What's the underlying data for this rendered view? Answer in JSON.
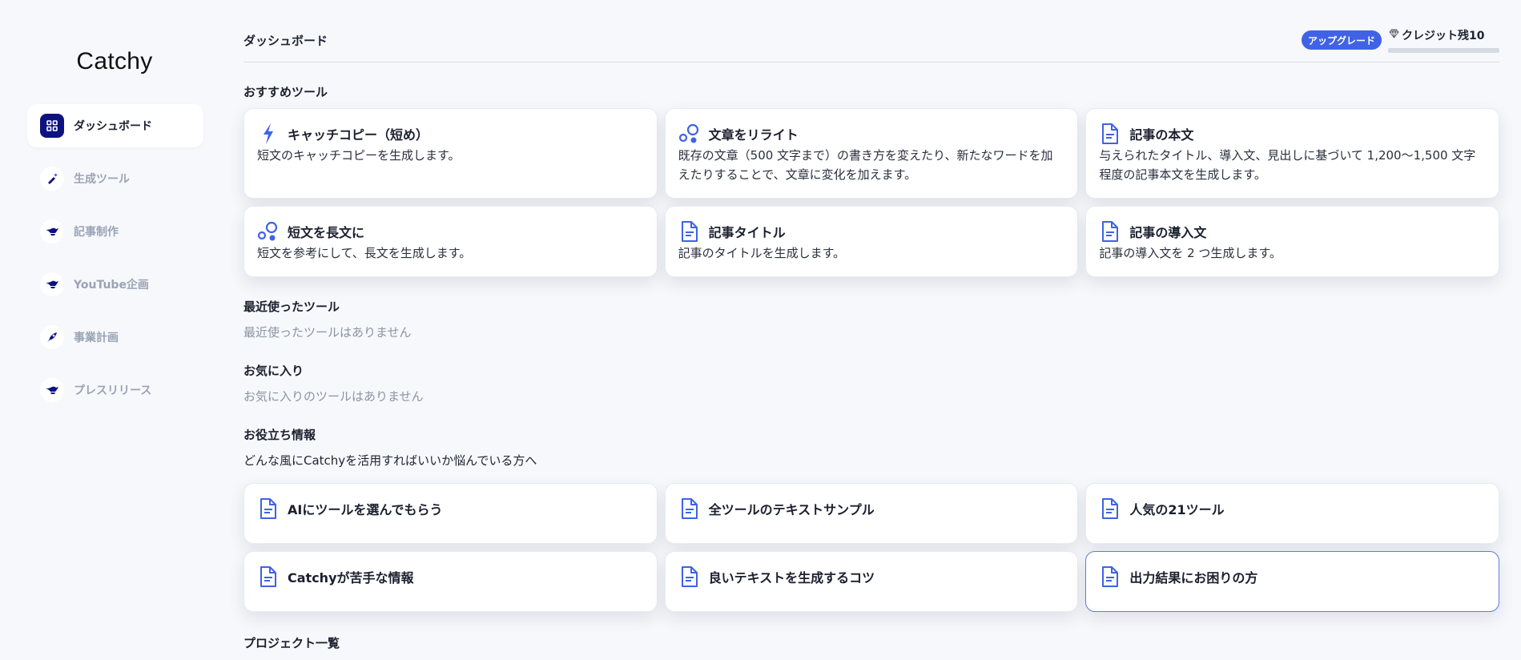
{
  "app": {
    "logo": "Catchy"
  },
  "sidebar": {
    "items": [
      {
        "label": "ダッシュボード",
        "icon": "grid-icon",
        "active": true
      },
      {
        "label": "生成ツール",
        "icon": "pen-icon",
        "active": false
      },
      {
        "label": "記事制作",
        "icon": "genie-lamp-icon",
        "active": false
      },
      {
        "label": "YouTube企画",
        "icon": "genie-lamp-icon",
        "active": false
      },
      {
        "label": "事業計画",
        "icon": "rocket-icon",
        "active": false
      },
      {
        "label": "プレスリリース",
        "icon": "genie-lamp-icon",
        "active": false
      }
    ]
  },
  "header": {
    "title": "ダッシュボード",
    "upgrade_label": "アップグレード",
    "credit_label": "クレジット残10",
    "credit_icon": "diamond-icon"
  },
  "colors": {
    "accent": "#3f62e6",
    "nav_active": "#0d1280",
    "icon": "#3f62e6"
  },
  "recommended": {
    "title": "おすすめツール",
    "tools": [
      {
        "title": "キャッチコピー（短め）",
        "desc": "短文のキャッチコピーを生成します。",
        "icon": "lightning-icon"
      },
      {
        "title": "文章をリライト",
        "desc": "既存の文章（500 文字まで）の書き方を変えたり、新たなワードを加えたりすることで、文章に変化を加えます。",
        "icon": "circles-icon"
      },
      {
        "title": "記事の本文",
        "desc": "与えられたタイトル、導入文、見出しに基づいて 1,200〜1,500 文字程度の記事本文を生成します。",
        "icon": "document-icon"
      },
      {
        "title": "短文を長文に",
        "desc": "短文を参考にして、長文を生成します。",
        "icon": "circles-icon"
      },
      {
        "title": "記事タイトル",
        "desc": "記事のタイトルを生成します。",
        "icon": "document-icon"
      },
      {
        "title": "記事の導入文",
        "desc": "記事の導入文を 2 つ生成します。",
        "icon": "document-icon"
      }
    ]
  },
  "recent": {
    "title": "最近使ったツール",
    "empty": "最近使ったツールはありません"
  },
  "favorites": {
    "title": "お気に入り",
    "empty": "お気に入りのツールはありません"
  },
  "info": {
    "title": "お役立ち情報",
    "subtitle": "どんな風にCatchyを活用すればいいか悩んでいる方へ",
    "items": [
      {
        "title": "AIにツールを選んでもらう",
        "icon": "document-icon"
      },
      {
        "title": "全ツールのテキストサンプル",
        "icon": "document-icon"
      },
      {
        "title": "人気の21ツール",
        "icon": "document-icon"
      },
      {
        "title": "Catchyが苦手な情報",
        "icon": "document-icon"
      },
      {
        "title": "良いテキストを生成するコツ",
        "icon": "document-icon"
      },
      {
        "title": "出力結果にお困りの方",
        "icon": "document-icon"
      }
    ]
  },
  "projects": {
    "title": "プロジェクト一覧"
  }
}
